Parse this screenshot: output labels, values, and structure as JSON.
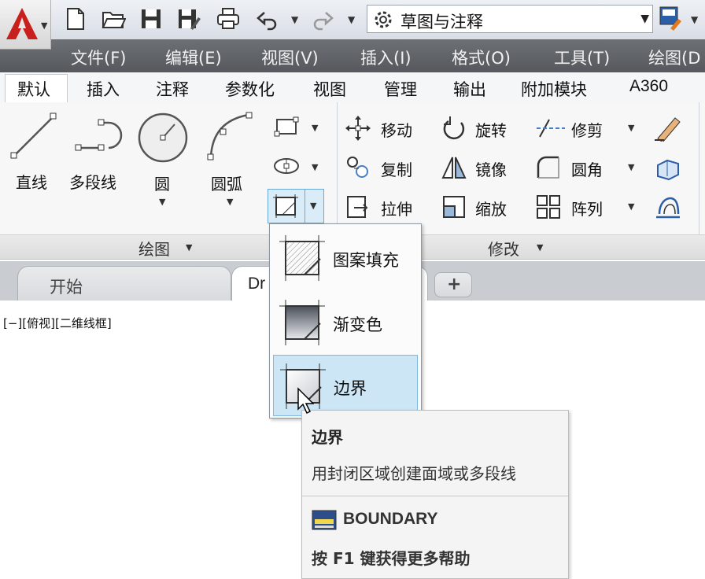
{
  "quick_access": {
    "workspace": "草图与注释",
    "icons": [
      "new-icon",
      "open-icon",
      "save-icon",
      "save-as-icon",
      "plot-icon",
      "undo-icon",
      "redo-icon",
      "gear-icon"
    ]
  },
  "menubar": [
    "文件(F)",
    "编辑(E)",
    "视图(V)",
    "插入(I)",
    "格式(O)",
    "工具(T)",
    "绘图(D"
  ],
  "ribbon_tabs": [
    "默认",
    "插入",
    "注释",
    "参数化",
    "视图",
    "管理",
    "输出",
    "附加模块",
    "A360"
  ],
  "active_tab": "默认",
  "draw_panel": {
    "title": "绘图",
    "line": "直线",
    "polyline": "多段线",
    "circle": "圆",
    "arc": "圆弧"
  },
  "modify_panel": {
    "title": "修改",
    "move": "移动",
    "rotate": "旋转",
    "trim": "修剪",
    "copy": "复制",
    "mirror": "镜像",
    "fillet": "圆角",
    "stretch": "拉伸",
    "scale": "缩放",
    "array": "阵列"
  },
  "doc_tabs": {
    "start": "开始",
    "drawing": "Dr",
    "new": "+"
  },
  "viewport_label": "[−][俯视][二维线框]",
  "dropdown": {
    "hatch": "图案填充",
    "gradient": "渐变色",
    "boundary": "边界"
  },
  "tooltip": {
    "title": "边界",
    "description": "用封闭区域创建面域或多段线",
    "command": "BOUNDARY",
    "help": "按 F1 键获得更多帮助"
  },
  "colors": {
    "accent_red": "#c8201d",
    "menubar": "#5f6267",
    "highlight": "#cce6f6"
  }
}
